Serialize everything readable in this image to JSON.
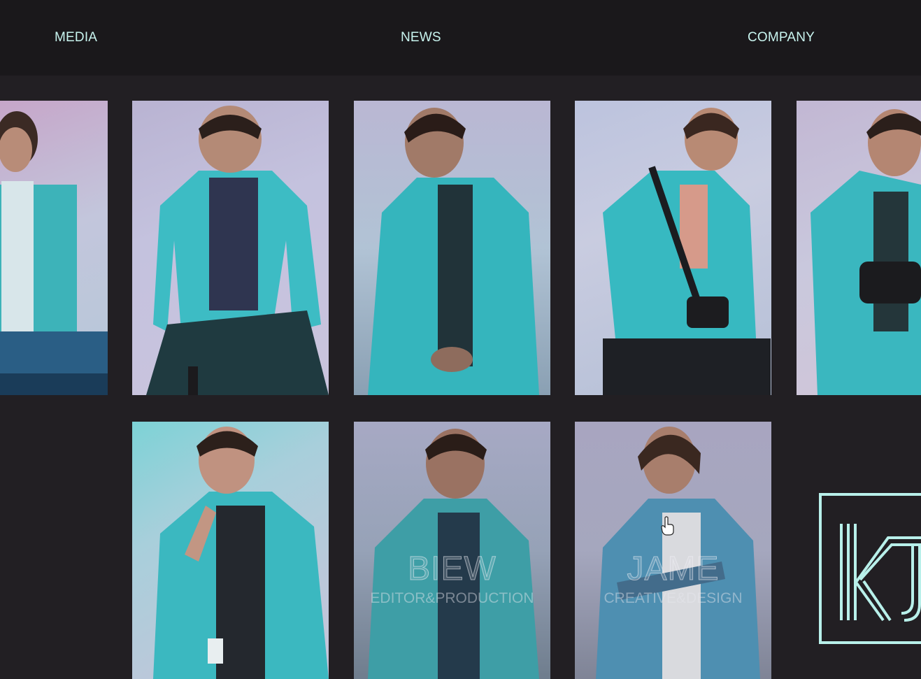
{
  "nav": {
    "media": "MEDIA",
    "news": "NEWS",
    "company": "COMPANY",
    "link_color": "#c8f4ef"
  },
  "members": {
    "biew": {
      "name": "BIEW",
      "role": "EDITOR&PRODUCTION"
    },
    "jame": {
      "name": "JAME",
      "role": "CREATIVE&DESIGN"
    }
  },
  "logo": {
    "letters": "KJ",
    "color": "#b8f0ea"
  },
  "colors": {
    "background": "#221f23",
    "nav_background": "#1a181b",
    "shirt": "#3fbcc2"
  }
}
